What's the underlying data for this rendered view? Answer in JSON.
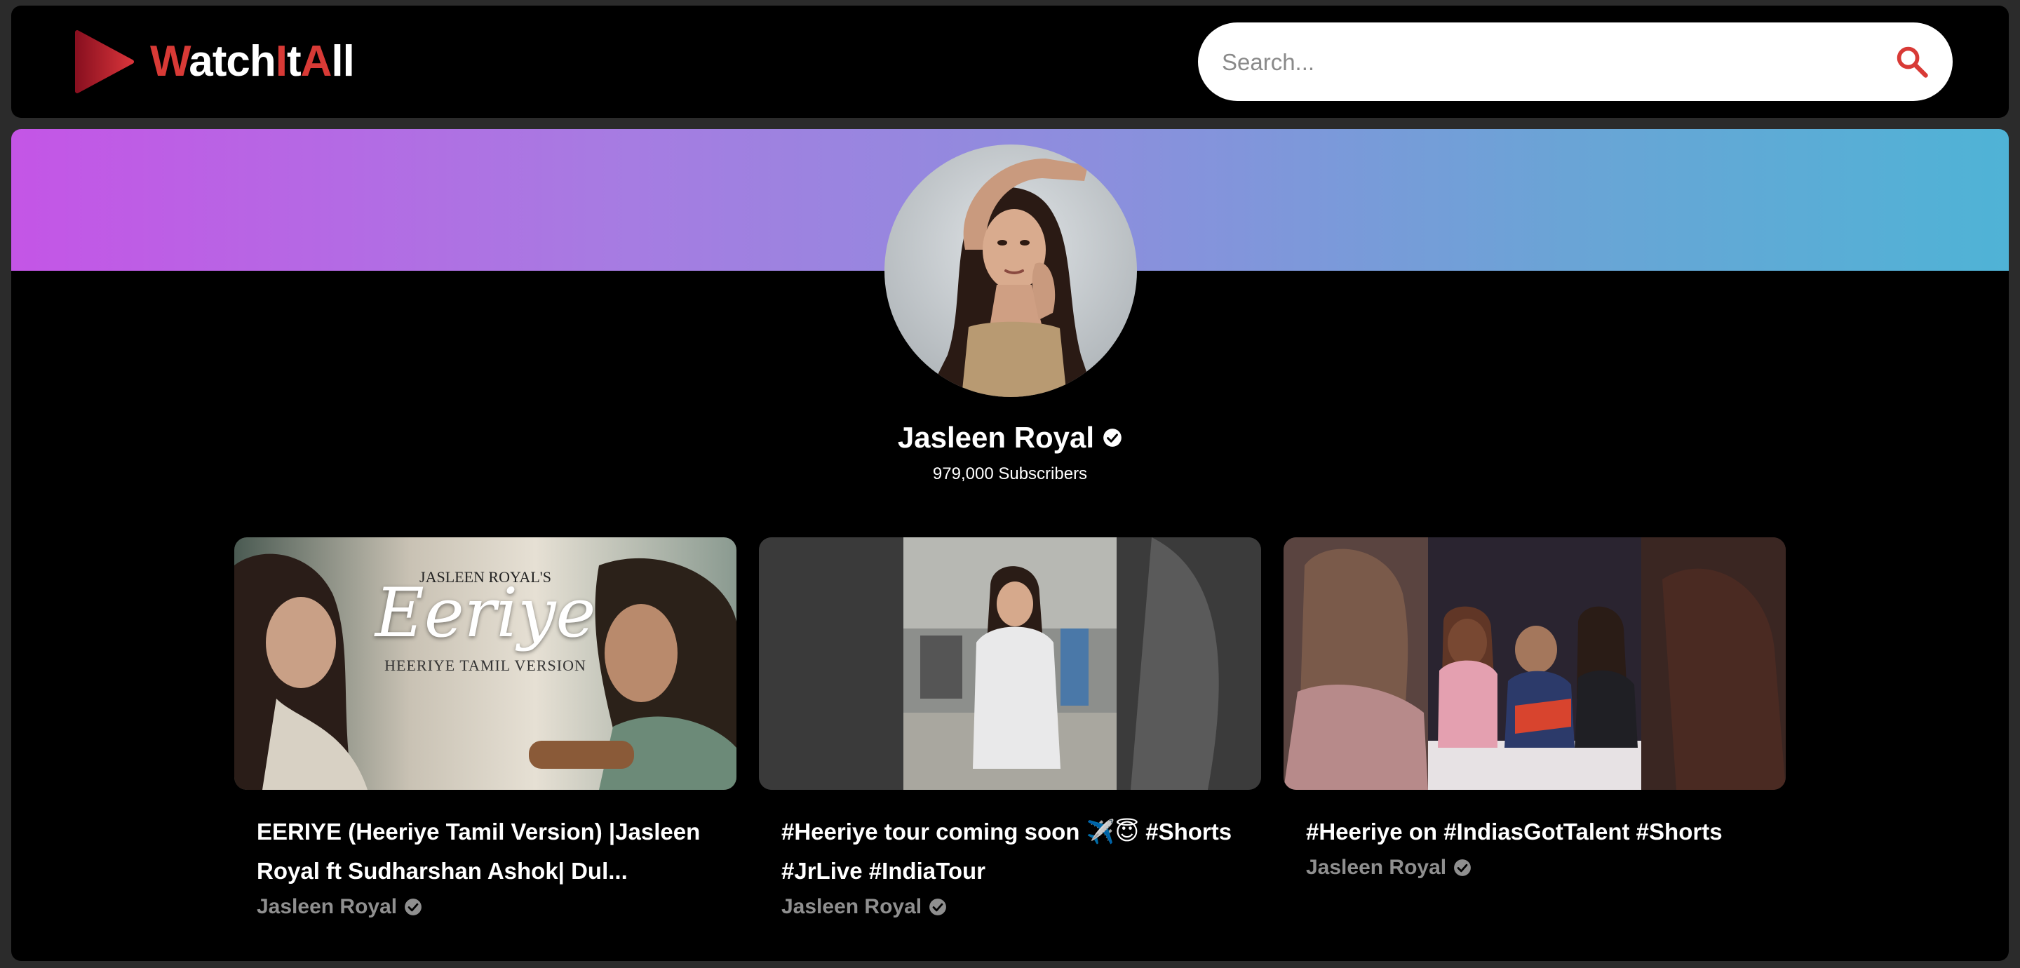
{
  "app": {
    "logo_parts": [
      "W",
      "atch",
      "I",
      "t",
      "A",
      "ll"
    ],
    "logo_colors": [
      "#d83a36",
      "#ffffff",
      "#d83a36",
      "#ffffff",
      "#d83a36",
      "#ffffff"
    ],
    "brand_color": "#d83a36"
  },
  "search": {
    "placeholder": "Search...",
    "value": "",
    "icon": "search-icon"
  },
  "channel": {
    "name": "Jasleen Royal",
    "subscribers": "979,000 Subscribers",
    "verified_icon": "verified-check-icon",
    "banner_gradient": [
      "#c455e6",
      "#4fb3d6"
    ]
  },
  "videos": [
    {
      "title_line1": "EERIYE (Heeriye Tamil Version) |Jasleen",
      "title_line2": "Royal ft Sudharshan Ashok| Dul...",
      "channel": "Jasleen Royal",
      "thumb_text": {
        "small_title": "JASLEEN ROYAL'S",
        "big_title": "Eeriye",
        "subtitle": "HEERIYE TAMIL VERSION"
      }
    },
    {
      "title_line1": "#Heeriye tour coming soon ✈️😇 #Shorts",
      "title_line2": "#JrLive #IndiaTour",
      "channel": "Jasleen Royal"
    },
    {
      "title_line1": "#Heeriye on #IndiasGotTalent #Shorts",
      "title_line2": "",
      "channel": "Jasleen Royal"
    }
  ]
}
